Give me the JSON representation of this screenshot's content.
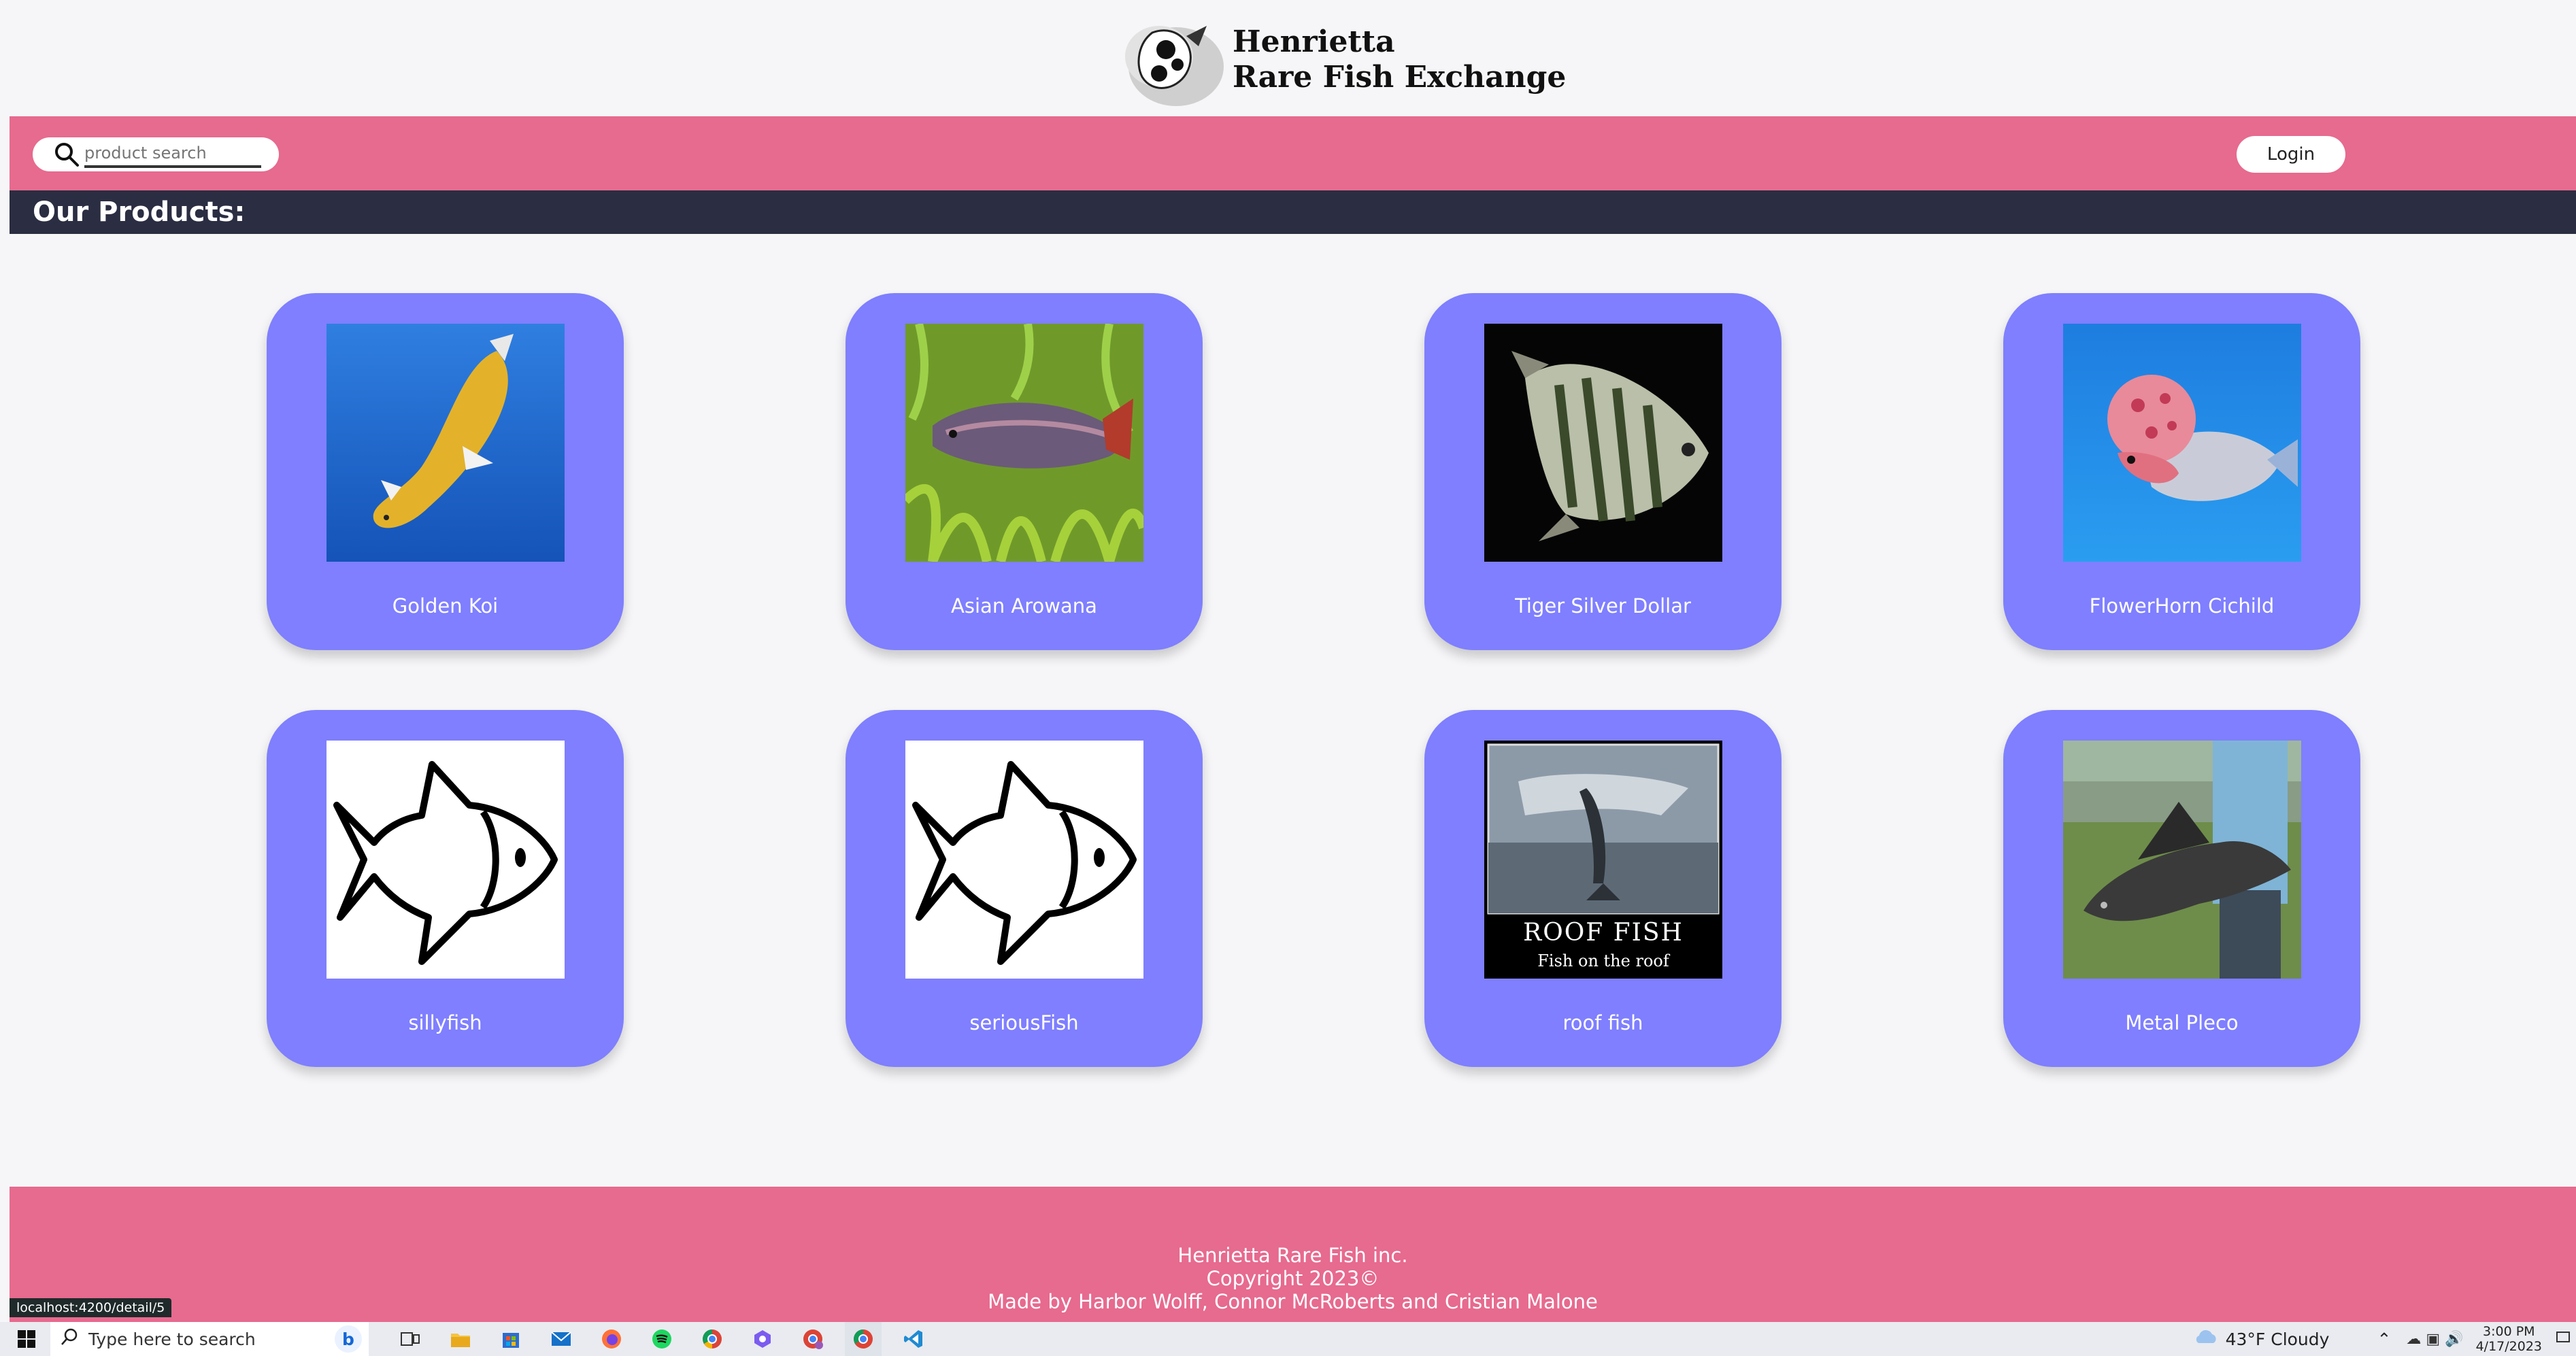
{
  "logo": {
    "line1": "Henrietta",
    "line2": "Rare Fish Exchange"
  },
  "search": {
    "placeholder": "product search"
  },
  "nav": {
    "login_label": "Login"
  },
  "heading": "Our Products:",
  "products": [
    {
      "name": "Golden Koi"
    },
    {
      "name": "Asian Arowana"
    },
    {
      "name": "Tiger Silver Dollar"
    },
    {
      "name": "FlowerHorn Cichild"
    },
    {
      "name": "sillyfish"
    },
    {
      "name": "seriousFish"
    },
    {
      "name": "roof fish",
      "poster_title": "ROOF FISH",
      "poster_caption": "Fish on the roof"
    },
    {
      "name": "Metal Pleco"
    }
  ],
  "footer": {
    "line1": "Henrietta Rare Fish inc.",
    "line2": "Copyright 2023©",
    "line3": "Made by Harbor Wolff, Connor McRoberts and Cristian Malone"
  },
  "status_url": "localhost:4200/detail/5",
  "taskbar": {
    "search_text": "Type here to search",
    "weather": "43°F  Cloudy",
    "time": "3:00 PM",
    "date": "4/17/2023"
  },
  "colors": {
    "accent_pink": "#e76a8f",
    "card": "#7f7fff",
    "heading_band": "#2b2d42"
  }
}
